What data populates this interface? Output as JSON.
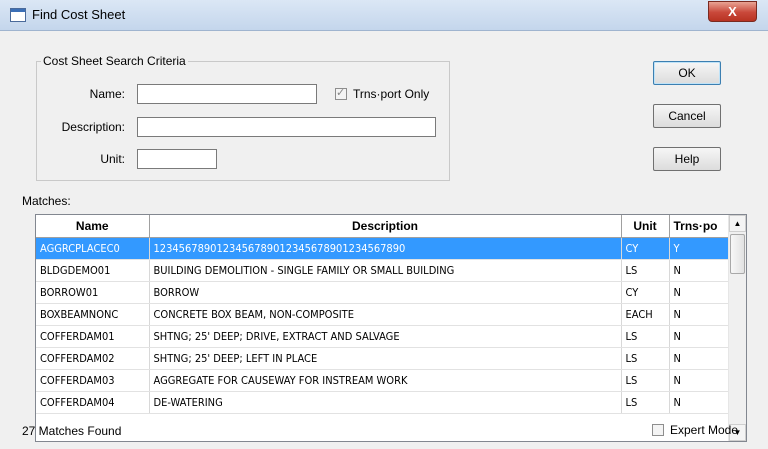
{
  "window": {
    "title": "Find Cost Sheet",
    "close_label": "X"
  },
  "criteria": {
    "group_label": "Cost Sheet Search Criteria",
    "name_label": "Name:",
    "name_value": "",
    "description_label": "Description:",
    "description_value": "",
    "unit_label": "Unit:",
    "unit_value": "",
    "trnsport_only_label": "Trns·port Only",
    "trnsport_only_checked": true
  },
  "buttons": {
    "ok": "OK",
    "cancel": "Cancel",
    "help": "Help"
  },
  "matches": {
    "label": "Matches:",
    "columns": [
      "Name",
      "Description",
      "Unit",
      "Trns·po"
    ],
    "rows": [
      [
        "AGGRCPLACEC0",
        "1234567890123456789012345678901234567890",
        "CY",
        "Y"
      ],
      [
        "BLDGDEMO01",
        "BUILDING DEMOLITION - SINGLE FAMILY OR SMALL BUILDING",
        "LS",
        "N"
      ],
      [
        "BORROW01",
        "BORROW",
        "CY",
        "N"
      ],
      [
        "BOXBEAMNONC",
        "CONCRETE BOX BEAM, NON-COMPOSITE",
        "EACH",
        "N"
      ],
      [
        "COFFERDAM01",
        "SHTNG; 25' DEEP; DRIVE, EXTRACT AND SALVAGE",
        "LS",
        "N"
      ],
      [
        "COFFERDAM02",
        "SHTNG; 25' DEEP; LEFT IN PLACE",
        "LS",
        "N"
      ],
      [
        "COFFERDAM03",
        "AGGREGATE FOR CAUSEWAY FOR INSTREAM WORK",
        "LS",
        "N"
      ],
      [
        "COFFERDAM04",
        "DE-WATERING",
        "LS",
        "N"
      ]
    ],
    "selected_row": 0
  },
  "status": {
    "count_text": "27 Matches Found",
    "expert_mode_label": "Expert Mode",
    "expert_mode_checked": false
  },
  "colors": {
    "selection": "#3399ff",
    "close_button": "#c9483a"
  }
}
